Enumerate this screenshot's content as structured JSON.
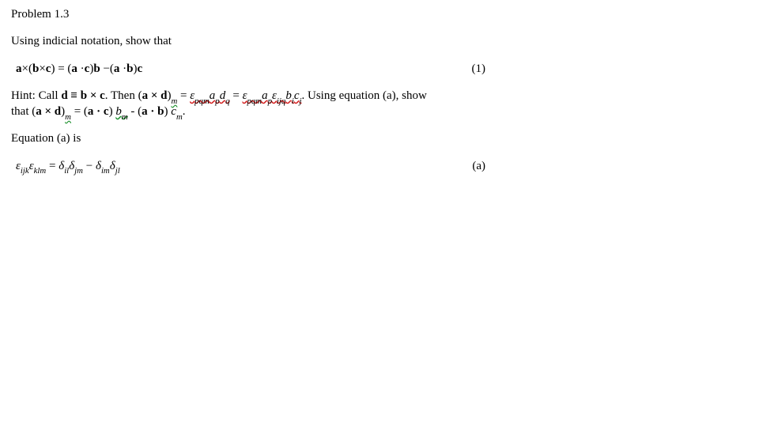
{
  "problem": {
    "title": "Problem 1.3",
    "intro": "Using indicial notation, show that",
    "eq1_number": "(1)",
    "hint_pre": "Hint: Call ",
    "hint_def_lhs": "d ≡ b × c",
    "hint_then": ".   Then (",
    "hint_axd": "a × d",
    "hint_close": ")",
    "hint_eq": " = ",
    "hint_term1a": "ε",
    "hint_term1a_sub": "pqm",
    "hint_term1b": "a",
    "hint_term1b_sub": "p",
    "hint_term1c": "d",
    "hint_term1c_sub": "q",
    "hint_term2a": "ε",
    "hint_term2a_sub": "pqm",
    "hint_term2b": "a",
    "hint_term2b_sub": "p",
    "hint_term2c": "ε",
    "hint_term2c_sub": "ijq",
    "hint_term2d": "b",
    "hint_term2d_sub": "i",
    "hint_term2e": "c",
    "hint_term2e_sub": "j",
    "hint_after": ".  Using equation (a), show",
    "hint_line2a": "that (",
    "hint_line2b": "a × d",
    "hint_line2c": ")",
    "hint_line2c_sub": "m",
    "hint_line2d": " = (",
    "hint_line2e": "a · c",
    "hint_line2f": ") ",
    "hint_line2g": "b",
    "hint_line2g_sub": "m",
    "hint_line2h": " - (",
    "hint_line2i": "a · b",
    "hint_line2j": ") ",
    "hint_line2k": "c",
    "hint_line2k_sub": "m",
    "hint_line2l": ".",
    "eqa_label": "Equation (a) is",
    "eqa_number": "(a)"
  },
  "eq1": {
    "a": "a",
    "times": "×",
    "lp": "(",
    "b": "b",
    "c": "c",
    "rp": ")",
    "eq": " = ",
    "dot": "·",
    "minus": "−"
  },
  "eqa": {
    "eps1": "ε",
    "sub1": "ijk",
    "eps2": "ε",
    "sub2": "klm",
    "eq": " = ",
    "d1": "δ",
    "d1s": "il",
    "d2": "δ",
    "d2s": "jm",
    "minus": " − ",
    "d3": "δ",
    "d3s": "im",
    "d4": "δ",
    "d4s": "jl"
  }
}
